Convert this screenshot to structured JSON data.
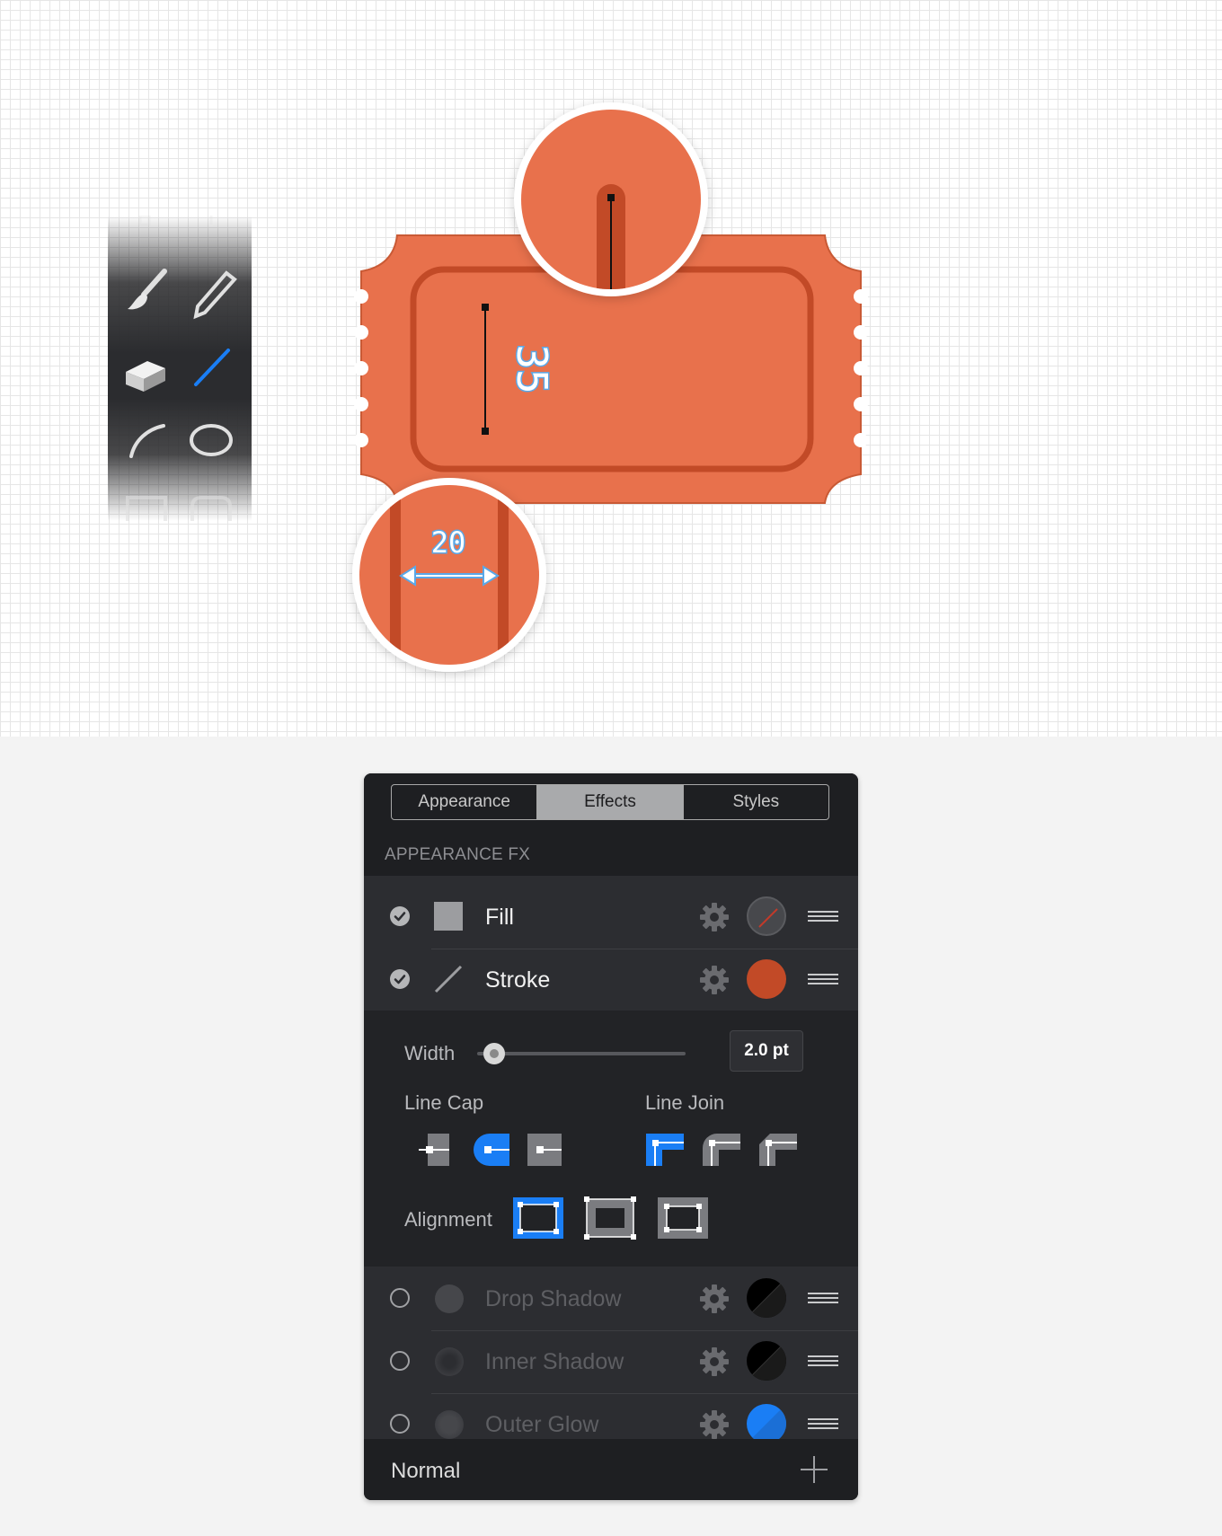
{
  "canvas": {
    "measurements": {
      "height_label": "35",
      "width_label": "20"
    }
  },
  "tools": [
    {
      "name": "brush"
    },
    {
      "name": "pencil"
    },
    {
      "name": "eraser"
    },
    {
      "name": "line",
      "active": true
    },
    {
      "name": "arc"
    },
    {
      "name": "ellipse"
    },
    {
      "name": "rectangle"
    },
    {
      "name": "rounded-rectangle"
    }
  ],
  "panel": {
    "tabs": [
      {
        "label": "Appearance",
        "active": false
      },
      {
        "label": "Effects",
        "active": true
      },
      {
        "label": "Styles",
        "active": false
      }
    ],
    "section_title": "APPEARANCE FX",
    "effects": [
      {
        "label": "Fill",
        "enabled": true,
        "swatch_color": "#47484c",
        "swatch": "none"
      },
      {
        "label": "Stroke",
        "enabled": true,
        "swatch_color": "#c24a27",
        "swatch": "solid"
      },
      {
        "label": "Drop Shadow",
        "enabled": false,
        "swatch_color": "#000000",
        "swatch": "half"
      },
      {
        "label": "Inner Shadow",
        "enabled": false,
        "swatch_color": "#000000",
        "swatch": "half"
      },
      {
        "label": "Outer Glow",
        "enabled": false,
        "swatch_color": "#1a7ef5",
        "swatch": "half"
      }
    ],
    "stroke_options": {
      "width_label": "Width",
      "width_value": "2.0 pt",
      "width_fraction": 0.08,
      "line_cap_label": "Line Cap",
      "line_cap_options": [
        "butt",
        "round",
        "square"
      ],
      "line_cap_selected": "round",
      "line_join_label": "Line Join",
      "line_join_options": [
        "miter",
        "round",
        "bevel"
      ],
      "line_join_selected": "miter",
      "alignment_label": "Alignment",
      "alignment_options": [
        "inside",
        "center",
        "outside"
      ],
      "alignment_selected": "inside"
    },
    "footer": {
      "blend_mode": "Normal"
    }
  },
  "colors": {
    "accent": "#1a7ef5",
    "ticket": "#e8714c",
    "ticket_stroke": "#c24a27",
    "measure_text": "#5aa8e8"
  }
}
